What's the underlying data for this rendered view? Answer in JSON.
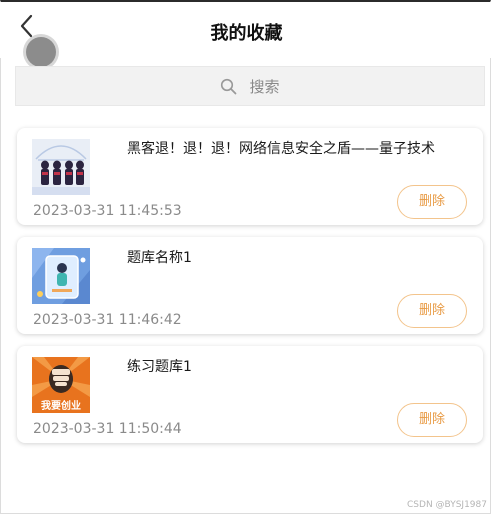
{
  "header": {
    "title": "我的收藏",
    "back_icon": "chevron-left-icon"
  },
  "search": {
    "placeholder": "搜索",
    "icon": "search-icon"
  },
  "items": [
    {
      "title": "黑客退！退！退！网络信息安全之盾——量子技术",
      "time": "2023-03-31 11:45:53",
      "delete_label": "删除"
    },
    {
      "title": "题库名称1",
      "time": "2023-03-31 11:46:42",
      "delete_label": "删除"
    },
    {
      "title": "练习题库1",
      "time": "2023-03-31 11:50:44",
      "delete_label": "删除"
    }
  ],
  "thumbnail_texts": {
    "item3": "我要创业"
  },
  "watermark": "CSDN @BYSJ1987",
  "colors": {
    "delete_text": "#e89a43",
    "delete_border": "#f3c48c",
    "search_bg": "#f2f2f2",
    "time_text": "#8a8a8a"
  }
}
